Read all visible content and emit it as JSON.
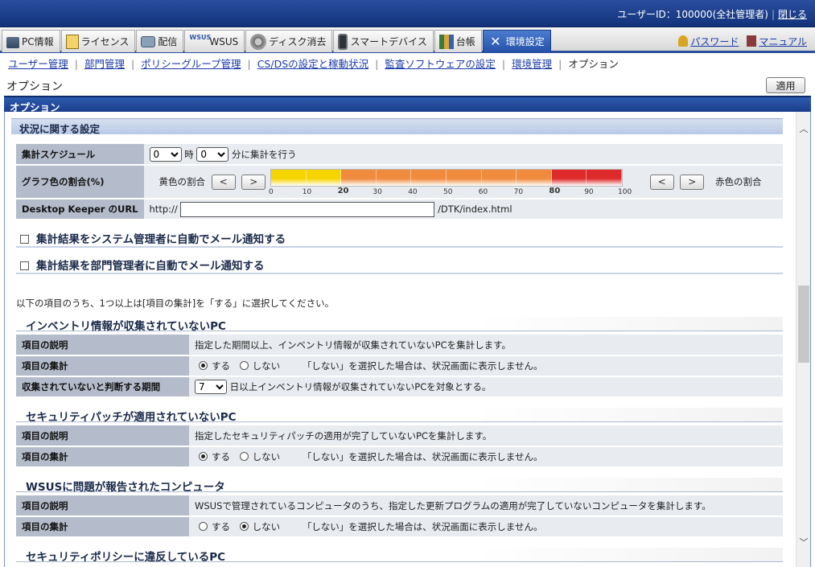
{
  "header": {
    "user_id_label": "ユーザーID：100000(全社管理者)",
    "close_label": "閉じる"
  },
  "tabs": [
    {
      "label": "PC情報",
      "icon": "pc-icon"
    },
    {
      "label": "ライセンス",
      "icon": "license-icon"
    },
    {
      "label": "配信",
      "icon": "distribution-icon"
    },
    {
      "label": "WSUS",
      "icon": "wsus-icon",
      "icon_text": "WSUS"
    },
    {
      "label": "ディスク消去",
      "icon": "disk-icon"
    },
    {
      "label": "スマートデバイス",
      "icon": "smartphone-icon"
    },
    {
      "label": "台帳",
      "icon": "ledger-icon"
    },
    {
      "label": "環境設定",
      "icon": "tools-icon",
      "active": true
    }
  ],
  "header_links": {
    "password": "パスワード",
    "manual": "マニュアル"
  },
  "subnav": [
    {
      "label": "ユーザー管理"
    },
    {
      "label": "部門管理"
    },
    {
      "label": "ポリシーグループ管理"
    },
    {
      "label": "CS/DSの設定と稼動状況"
    },
    {
      "label": "監査ソフトウェアの設定"
    },
    {
      "label": "環境管理"
    },
    {
      "label": "オプション",
      "current": true
    }
  ],
  "page": {
    "title": "オプション",
    "apply_label": "適用",
    "section_title": "オプション"
  },
  "status_settings": {
    "title": "状況に関する設定",
    "schedule_label": "集計スケジュール",
    "hour_value": "0",
    "hour_unit": "時",
    "minute_value": "0",
    "minute_suffix": "分に集計を行う",
    "ratio_label": "グラフ色の割合(%)",
    "yellow_label": "黄色の割合",
    "red_label": "赤色の割合",
    "prev_glyph": "<",
    "next_glyph": ">",
    "ticks": [
      "0",
      "10",
      "20",
      "30",
      "40",
      "50",
      "60",
      "70",
      "80",
      "90",
      "100"
    ],
    "yellow_pct": 20,
    "red_pct": 80,
    "colors": {
      "yellow": "#f5d400",
      "orange": "#f08a3c",
      "red": "#de2a2a"
    },
    "url_label": "Desktop Keeper のURL",
    "url_prefix": "http://",
    "url_value": "",
    "url_suffix": "/DTK/index.html"
  },
  "mail_options": [
    {
      "label": "集計結果をシステム管理者に自動でメール通知する",
      "checked": false
    },
    {
      "label": "集計結果を部門管理者に自動でメール通知する",
      "checked": false
    }
  ],
  "note": "以下の項目のうち、1つ以上は[項目の集計]を「する」に選択してください。",
  "common": {
    "desc_label": "項目の説明",
    "agg_label": "項目の集計",
    "yes": "する",
    "no": "しない",
    "hint": "「しない」を選択した場合は、状況画面に表示しません。"
  },
  "items": [
    {
      "title": "インベントリ情報が収集されていないPC",
      "desc": "指定した期間以上、インベントリ情報が収集されていないPCを集計します。",
      "aggregate": true,
      "period_label": "収集されていないと判断する期間",
      "period_value": "7",
      "period_suffix": "日以上インベントリ情報が収集されていないPCを対象とする。"
    },
    {
      "title": "セキュリティパッチが適用されていないPC",
      "desc": "指定したセキュリティパッチの適用が完了していないPCを集計します。",
      "aggregate": true
    },
    {
      "title": "WSUSに問題が報告されたコンピュータ",
      "desc": "WSUSで管理されているコンピュータのうち、指定した更新プログラムの適用が完了していないコンピュータを集計します。",
      "aggregate": false
    },
    {
      "title": "セキュリティポリシーに違反しているPC"
    }
  ]
}
